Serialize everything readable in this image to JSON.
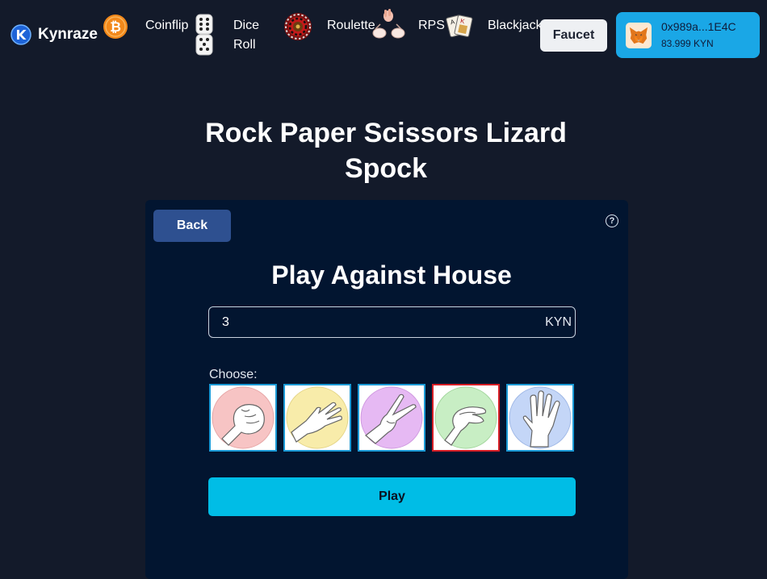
{
  "header": {
    "brand": "Kynraze",
    "nav": [
      {
        "label": "Coinflip",
        "icon": "bitcoin-coin-icon"
      },
      {
        "label": "Dice\nRoll",
        "icon": "dice-icon"
      },
      {
        "label": "Roulette",
        "icon": "roulette-wheel-icon"
      },
      {
        "label": "RPS",
        "icon": "hand-gestures-icon"
      },
      {
        "label": "Blackjack",
        "icon": "playing-cards-icon"
      }
    ],
    "faucet_label": "Faucet",
    "wallet": {
      "address": "0x989a...1E4C",
      "balance": "83.999 KYN",
      "icon": "metamask-fox-icon"
    }
  },
  "page": {
    "title": "Rock Paper Scissors Lizard Spock"
  },
  "game": {
    "back_label": "Back",
    "help_icon": "help-icon",
    "heading": "Play Against House",
    "bet_value": "3",
    "bet_unit": "KYN",
    "choose_label": "Choose:",
    "choices": [
      {
        "name": "rock",
        "color": "#f7c4c4"
      },
      {
        "name": "paper",
        "color": "#f8ecaa"
      },
      {
        "name": "scissors",
        "color": "#e6b9f3"
      },
      {
        "name": "lizard",
        "color": "#c8eec4",
        "selected": true
      },
      {
        "name": "spock",
        "color": "#c4d6f7"
      }
    ],
    "play_label": "Play"
  },
  "colors": {
    "background": "#131a2a",
    "card": "#021530",
    "accent": "#00bde6",
    "wallet": "#1aa7e6",
    "back_button": "#2e5090",
    "selected_border": "#d81f26",
    "choice_border": "#1b9ad6"
  }
}
